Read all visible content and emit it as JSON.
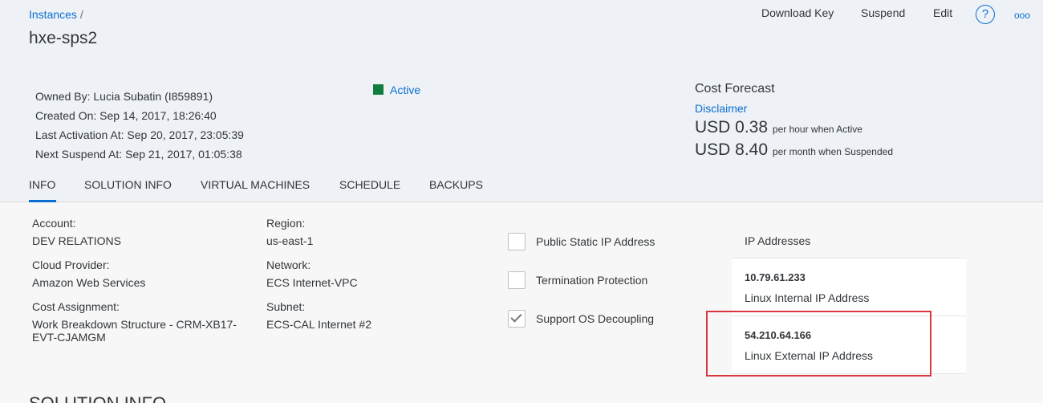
{
  "breadcrumb": {
    "parent": "Instances",
    "separator": "/"
  },
  "instance": {
    "name": "hxe-sps2"
  },
  "actions": {
    "download_key": "Download Key",
    "suspend": "Suspend",
    "edit": "Edit",
    "help_glyph": "?",
    "more_glyph": "ooo"
  },
  "meta": {
    "owned_by": "Owned By: Lucia Subatin (I859891)",
    "created_on": "Created On: Sep 14, 2017, 18:26:40",
    "last_activation": "Last Activation At: Sep 20, 2017, 23:05:39",
    "next_suspend": "Next Suspend At: Sep 21, 2017, 01:05:38"
  },
  "status": {
    "label": "Active",
    "color": "#107e3e"
  },
  "cost": {
    "title": "Cost Forecast",
    "disclaimer": "Disclaimer",
    "hourly_amount": "USD 0.38",
    "hourly_note": "per hour when Active",
    "monthly_amount": "USD 8.40",
    "monthly_note": "per month when Suspended"
  },
  "tabs": [
    {
      "label": "INFO"
    },
    {
      "label": "SOLUTION INFO"
    },
    {
      "label": "VIRTUAL MACHINES"
    },
    {
      "label": "SCHEDULE"
    },
    {
      "label": "BACKUPS"
    }
  ],
  "info": {
    "account_label": "Account:",
    "account_value": "DEV RELATIONS",
    "cloud_label": "Cloud Provider:",
    "cloud_value": "Amazon Web Services",
    "cost_label": "Cost Assignment:",
    "cost_value_1": "Work Breakdown Structure - CRM-XB17-",
    "cost_value_2": "EVT-CJAMGM",
    "region_label": "Region:",
    "region_value": "us-east-1",
    "network_label": "Network:",
    "network_value": "ECS Internet-VPC",
    "subnet_label": "Subnet:",
    "subnet_value": "ECS-CAL Internet #2"
  },
  "options": [
    {
      "label": "Public Static IP Address",
      "checked": false
    },
    {
      "label": "Termination Protection",
      "checked": false
    },
    {
      "label": "Support OS Decoupling",
      "checked": true
    }
  ],
  "ip_panel": {
    "title": "IP Addresses",
    "rows": [
      {
        "ip": "10.79.61.233",
        "desc": "Linux Internal IP Address"
      },
      {
        "ip": "54.210.64.166",
        "desc": "Linux External IP Address"
      }
    ]
  },
  "next_section": {
    "title": "SOLUTION INFO"
  },
  "colors": {
    "accent": "#0a6ed1",
    "highlight": "#d9363e",
    "active": "#107e3e"
  }
}
